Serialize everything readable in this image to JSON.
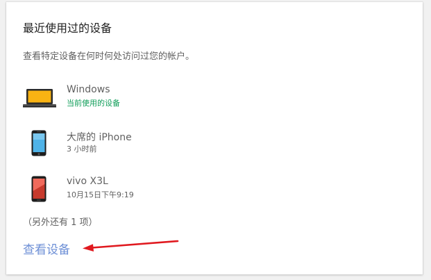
{
  "card": {
    "title": "最近使用过的设备",
    "subtitle": "查看特定设备在何时何处访问过您的帐户。"
  },
  "devices": [
    {
      "name": "Windows",
      "status": "当前使用的设备",
      "icon": "laptop-icon",
      "is_current": true
    },
    {
      "name": "大席的 iPhone",
      "status": "3 小时前",
      "icon": "iphone-icon",
      "is_current": false
    },
    {
      "name": "vivo X3L",
      "status": "10月15日下午9:19",
      "icon": "android-phone-icon",
      "is_current": false
    }
  ],
  "more_note": "（另外还有 1 项）",
  "view_devices_link": "查看设备",
  "colors": {
    "current_status": "#0f9d58",
    "link": "#6d8fd6",
    "annotation_arrow": "#e0191f"
  }
}
